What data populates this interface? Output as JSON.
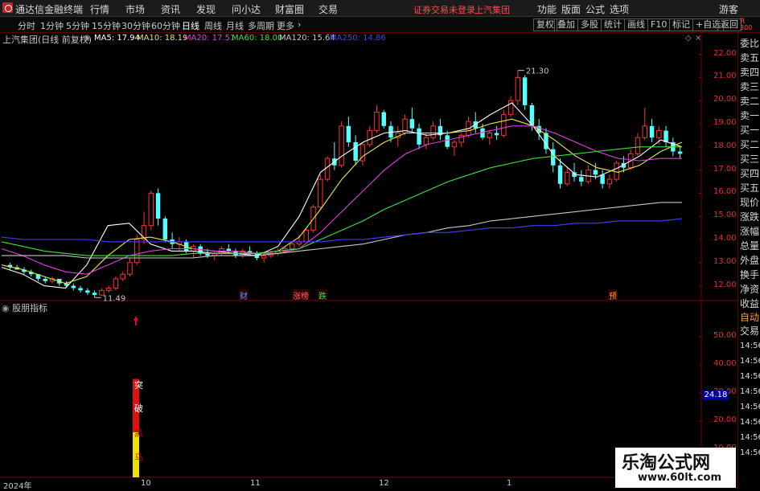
{
  "menubar": {
    "app_title": "通达信金融终端",
    "items": [
      "行情",
      "市场",
      "资讯",
      "发现",
      "问小达",
      "财富圈",
      "交易"
    ],
    "notice": "证券交易未登录",
    "stock_name": "上汽集团",
    "right_items": [
      "功能",
      "版面",
      "公式",
      "选项"
    ],
    "guest": "游客"
  },
  "periods": [
    "分时",
    "1分钟",
    "5分钟",
    "15分钟",
    "30分钟",
    "60分钟",
    "日线",
    "周线",
    "月线",
    "多周期",
    "更多"
  ],
  "active_period": "日线",
  "toolbar_buttons": [
    "复权",
    "叠加",
    "多股",
    "统计",
    "画线",
    "F10",
    "标记",
    "+自选",
    "返回"
  ],
  "chart_header": {
    "title": "上汽集团(日线 前复权)",
    "ma": [
      {
        "label": "MA5: 17.94",
        "color": "#ffffff"
      },
      {
        "label": "MA10: 18.19",
        "color": "#e8e84a"
      },
      {
        "label": "MA20: 17.51",
        "color": "#e040e0"
      },
      {
        "label": "MA60: 18.00",
        "color": "#40e040"
      },
      {
        "label": "MA120: 15.64",
        "color": "#c8c8c8"
      },
      {
        "label": "MA250: 14.86",
        "color": "#4040ff"
      }
    ],
    "diamond": "◇"
  },
  "price_axis": [
    "22.00",
    "21.00",
    "20.00",
    "19.00",
    "18.00",
    "17.00",
    "16.00",
    "15.00",
    "14.00",
    "13.00",
    "12.00"
  ],
  "annotations": {
    "high": "21.30",
    "low": "11.49"
  },
  "events": [
    {
      "label": "财",
      "color": "#4aa0ff"
    },
    {
      "label": "涨榜",
      "color": "#ff6060"
    },
    {
      "label": "跌",
      "color": "#40e040"
    },
    {
      "label": "预",
      "color": "#ff9a30"
    }
  ],
  "sub_panel": {
    "title": "股朋指标",
    "axis": [
      "50.00",
      "40.00",
      "30.00",
      "20.00",
      "10.00"
    ],
    "current_value": "24.18",
    "bar_red_text": [
      "突",
      "破"
    ],
    "bar_yellow_text": [
      "黑",
      "马"
    ]
  },
  "date_labels": [
    "2024年",
    "10",
    "11",
    "12",
    "1"
  ],
  "sidebar": {
    "top": "R",
    "top2": "300",
    "items": [
      "委比",
      "卖五",
      "卖四",
      "卖三",
      "卖二",
      "卖一",
      "买一",
      "买二",
      "买三",
      "买四",
      "买五",
      "现价",
      "涨跌",
      "涨幅",
      "总量",
      "外盘",
      "换手",
      "净资",
      "收益"
    ],
    "auto": "自动",
    "trade": "交易",
    "times": [
      "14:56",
      "14:56",
      "14:56",
      "14:56",
      "14:56",
      "14:56",
      "14:56",
      "14:56"
    ]
  },
  "colors": {
    "up": "#ff3232",
    "down": "#54ffff",
    "accent": "#c0262c"
  },
  "chart_data": {
    "type": "candlestick",
    "title": "上汽集团(日线 前复权)",
    "ylim": [
      11.5,
      22.4
    ],
    "series": [
      {
        "name": "K线",
        "ohlc": [
          [
            12.9,
            13.0,
            12.7,
            12.8
          ],
          [
            12.8,
            12.9,
            12.7,
            12.7
          ],
          [
            12.7,
            12.8,
            12.5,
            12.6
          ],
          [
            12.6,
            12.7,
            12.4,
            12.5
          ],
          [
            12.5,
            12.5,
            12.2,
            12.3
          ],
          [
            12.3,
            12.4,
            12.1,
            12.2
          ],
          [
            12.2,
            12.4,
            12.1,
            12.3
          ],
          [
            12.3,
            12.3,
            12.0,
            12.1
          ],
          [
            12.1,
            12.2,
            11.9,
            12.0
          ],
          [
            12.0,
            12.1,
            11.8,
            11.9
          ],
          [
            11.9,
            12.0,
            11.7,
            11.8
          ],
          [
            11.8,
            11.9,
            11.6,
            11.7
          ],
          [
            11.7,
            11.8,
            11.49,
            11.6
          ],
          [
            11.6,
            11.9,
            11.55,
            11.8
          ],
          [
            11.8,
            12.0,
            11.7,
            11.9
          ],
          [
            11.9,
            12.4,
            11.8,
            12.3
          ],
          [
            12.3,
            12.6,
            12.2,
            12.5
          ],
          [
            12.5,
            13.2,
            12.4,
            13.0
          ],
          [
            13.0,
            14.2,
            12.9,
            14.0
          ],
          [
            14.0,
            15.2,
            13.8,
            14.6
          ],
          [
            14.6,
            16.1,
            14.4,
            16.0
          ],
          [
            16.0,
            16.2,
            14.6,
            14.9
          ],
          [
            14.9,
            15.0,
            13.9,
            14.0
          ],
          [
            14.0,
            14.3,
            13.6,
            13.8
          ],
          [
            13.8,
            14.1,
            13.5,
            13.9
          ],
          [
            13.9,
            14.0,
            13.4,
            13.5
          ],
          [
            13.5,
            13.8,
            13.2,
            13.7
          ],
          [
            13.7,
            13.8,
            13.3,
            13.4
          ],
          [
            13.4,
            13.6,
            13.2,
            13.3
          ],
          [
            13.3,
            13.5,
            13.1,
            13.4
          ],
          [
            13.4,
            13.7,
            13.3,
            13.6
          ],
          [
            13.6,
            13.8,
            13.4,
            13.5
          ],
          [
            13.5,
            13.6,
            13.2,
            13.3
          ],
          [
            13.3,
            13.6,
            13.2,
            13.5
          ],
          [
            13.5,
            13.7,
            13.3,
            13.4
          ],
          [
            13.4,
            13.5,
            13.1,
            13.2
          ],
          [
            13.2,
            13.4,
            13.0,
            13.3
          ],
          [
            13.3,
            13.5,
            13.2,
            13.4
          ],
          [
            13.4,
            13.6,
            13.3,
            13.5
          ],
          [
            13.5,
            13.7,
            13.4,
            13.6
          ],
          [
            13.6,
            13.9,
            13.5,
            13.8
          ],
          [
            13.8,
            14.2,
            13.7,
            13.9
          ],
          [
            13.9,
            14.5,
            13.9,
            14.4
          ],
          [
            14.4,
            15.5,
            14.3,
            15.4
          ],
          [
            15.4,
            16.8,
            15.3,
            16.6
          ],
          [
            16.6,
            17.6,
            16.5,
            17.5
          ],
          [
            17.5,
            18.2,
            17.0,
            17.2
          ],
          [
            17.2,
            19.1,
            17.1,
            18.9
          ],
          [
            18.9,
            19.3,
            18.0,
            18.2
          ],
          [
            18.2,
            18.5,
            17.2,
            17.4
          ],
          [
            17.4,
            18.2,
            17.2,
            18.1
          ],
          [
            18.1,
            18.9,
            18.0,
            18.7
          ],
          [
            18.7,
            19.8,
            18.6,
            19.5
          ],
          [
            19.5,
            19.6,
            18.8,
            18.9
          ],
          [
            18.9,
            19.1,
            18.2,
            18.4
          ],
          [
            18.4,
            18.9,
            18.0,
            18.6
          ],
          [
            18.6,
            19.4,
            18.5,
            19.2
          ],
          [
            19.2,
            19.7,
            18.6,
            18.8
          ],
          [
            18.8,
            19.0,
            17.9,
            18.1
          ],
          [
            18.1,
            18.6,
            17.9,
            18.4
          ],
          [
            18.4,
            19.1,
            18.3,
            18.9
          ],
          [
            18.9,
            19.2,
            18.3,
            18.5
          ],
          [
            18.5,
            18.7,
            17.9,
            18.0
          ],
          [
            18.0,
            18.3,
            17.6,
            18.2
          ],
          [
            18.2,
            18.6,
            18.0,
            18.5
          ],
          [
            18.5,
            19.3,
            18.4,
            19.1
          ],
          [
            19.1,
            19.5,
            18.6,
            18.8
          ],
          [
            18.8,
            19.0,
            18.3,
            18.4
          ],
          [
            18.4,
            18.7,
            18.1,
            18.6
          ],
          [
            18.6,
            18.9,
            18.3,
            18.5
          ],
          [
            18.5,
            19.6,
            18.4,
            19.4
          ],
          [
            19.4,
            20.2,
            19.3,
            20.0
          ],
          [
            20.0,
            21.3,
            19.8,
            21.0
          ],
          [
            21.0,
            21.1,
            19.6,
            19.8
          ],
          [
            19.8,
            19.9,
            18.7,
            18.9
          ],
          [
            18.9,
            19.2,
            18.3,
            18.6
          ],
          [
            18.6,
            18.8,
            17.7,
            17.9
          ],
          [
            17.9,
            18.2,
            16.9,
            17.2
          ],
          [
            17.2,
            17.5,
            16.2,
            16.4
          ],
          [
            16.4,
            17.1,
            16.3,
            16.9
          ],
          [
            16.9,
            17.3,
            16.5,
            16.7
          ],
          [
            16.7,
            17.0,
            16.3,
            16.5
          ],
          [
            16.5,
            17.2,
            16.4,
            17.0
          ],
          [
            17.0,
            17.3,
            16.6,
            16.8
          ],
          [
            16.8,
            17.0,
            16.2,
            16.4
          ],
          [
            16.4,
            16.8,
            16.2,
            16.6
          ],
          [
            16.6,
            17.4,
            16.5,
            17.3
          ],
          [
            17.3,
            17.6,
            16.9,
            17.1
          ],
          [
            17.1,
            17.9,
            17.0,
            17.7
          ],
          [
            17.7,
            18.6,
            17.6,
            18.4
          ],
          [
            18.4,
            19.7,
            18.3,
            18.9
          ],
          [
            18.9,
            19.2,
            18.2,
            18.4
          ],
          [
            18.4,
            18.9,
            18.1,
            18.7
          ],
          [
            18.7,
            18.9,
            18.0,
            18.2
          ],
          [
            18.2,
            18.4,
            17.6,
            17.8
          ],
          [
            17.8,
            18.0,
            17.5,
            17.7
          ]
        ]
      },
      {
        "name": "MA5",
        "values": [
          12.8,
          12.5,
          12.0,
          11.9,
          12.9,
          14.6,
          14.7,
          13.8,
          13.5,
          13.5,
          13.4,
          13.4,
          13.3,
          13.7,
          15.0,
          16.9,
          17.6,
          18.2,
          18.6,
          18.7,
          18.5,
          18.6,
          18.8,
          19.4,
          19.9,
          18.9,
          17.6,
          16.8,
          16.7,
          17.1,
          17.6,
          18.3,
          18.0
        ]
      },
      {
        "name": "MA10",
        "values": [
          12.9,
          12.7,
          12.4,
          12.1,
          12.4,
          13.3,
          14.0,
          14.1,
          13.9,
          13.6,
          13.5,
          13.4,
          13.4,
          13.5,
          14.1,
          15.3,
          16.6,
          17.6,
          18.2,
          18.6,
          18.6,
          18.6,
          18.7,
          19.0,
          19.2,
          18.9,
          18.3,
          17.6,
          17.1,
          16.9,
          17.2,
          17.8,
          18.2
        ]
      },
      {
        "name": "MA20",
        "values": [
          13.6,
          13.3,
          12.9,
          12.6,
          12.5,
          12.9,
          13.3,
          13.5,
          13.6,
          13.6,
          13.5,
          13.5,
          13.4,
          13.4,
          13.6,
          14.3,
          15.2,
          16.1,
          17.0,
          17.7,
          18.1,
          18.3,
          18.5,
          18.7,
          18.9,
          18.9,
          18.6,
          18.2,
          17.8,
          17.5,
          17.4,
          17.5,
          17.5
        ]
      },
      {
        "name": "MA60",
        "values": [
          13.9,
          13.7,
          13.5,
          13.4,
          13.3,
          13.3,
          13.3,
          13.3,
          13.3,
          13.4,
          13.4,
          13.4,
          13.4,
          13.5,
          13.6,
          14.0,
          14.4,
          14.8,
          15.3,
          15.7,
          16.1,
          16.5,
          16.8,
          17.1,
          17.3,
          17.5,
          17.6,
          17.7,
          17.8,
          17.9,
          18.0,
          18.0,
          18.0
        ]
      },
      {
        "name": "MA120",
        "values": [
          13.3,
          13.3,
          13.3,
          13.3,
          13.2,
          13.2,
          13.2,
          13.2,
          13.2,
          13.2,
          13.3,
          13.3,
          13.3,
          13.4,
          13.5,
          13.6,
          13.7,
          13.8,
          14.0,
          14.2,
          14.3,
          14.5,
          14.6,
          14.8,
          14.9,
          15.0,
          15.1,
          15.2,
          15.3,
          15.4,
          15.5,
          15.6,
          15.6
        ]
      },
      {
        "name": "MA250",
        "values": [
          14.1,
          14.0,
          14.0,
          14.0,
          14.0,
          13.9,
          13.9,
          13.9,
          13.9,
          13.9,
          13.9,
          13.9,
          13.9,
          13.9,
          13.9,
          13.9,
          14.0,
          14.0,
          14.1,
          14.2,
          14.3,
          14.3,
          14.4,
          14.5,
          14.5,
          14.6,
          14.6,
          14.7,
          14.7,
          14.8,
          14.8,
          14.8,
          14.9
        ]
      }
    ],
    "sub_indicator": {
      "name": "股朋指标",
      "ylim": [
        0,
        60
      ],
      "signal_bar": {
        "low": 0,
        "mid": 16,
        "high": 35
      },
      "value": 24.18
    }
  }
}
